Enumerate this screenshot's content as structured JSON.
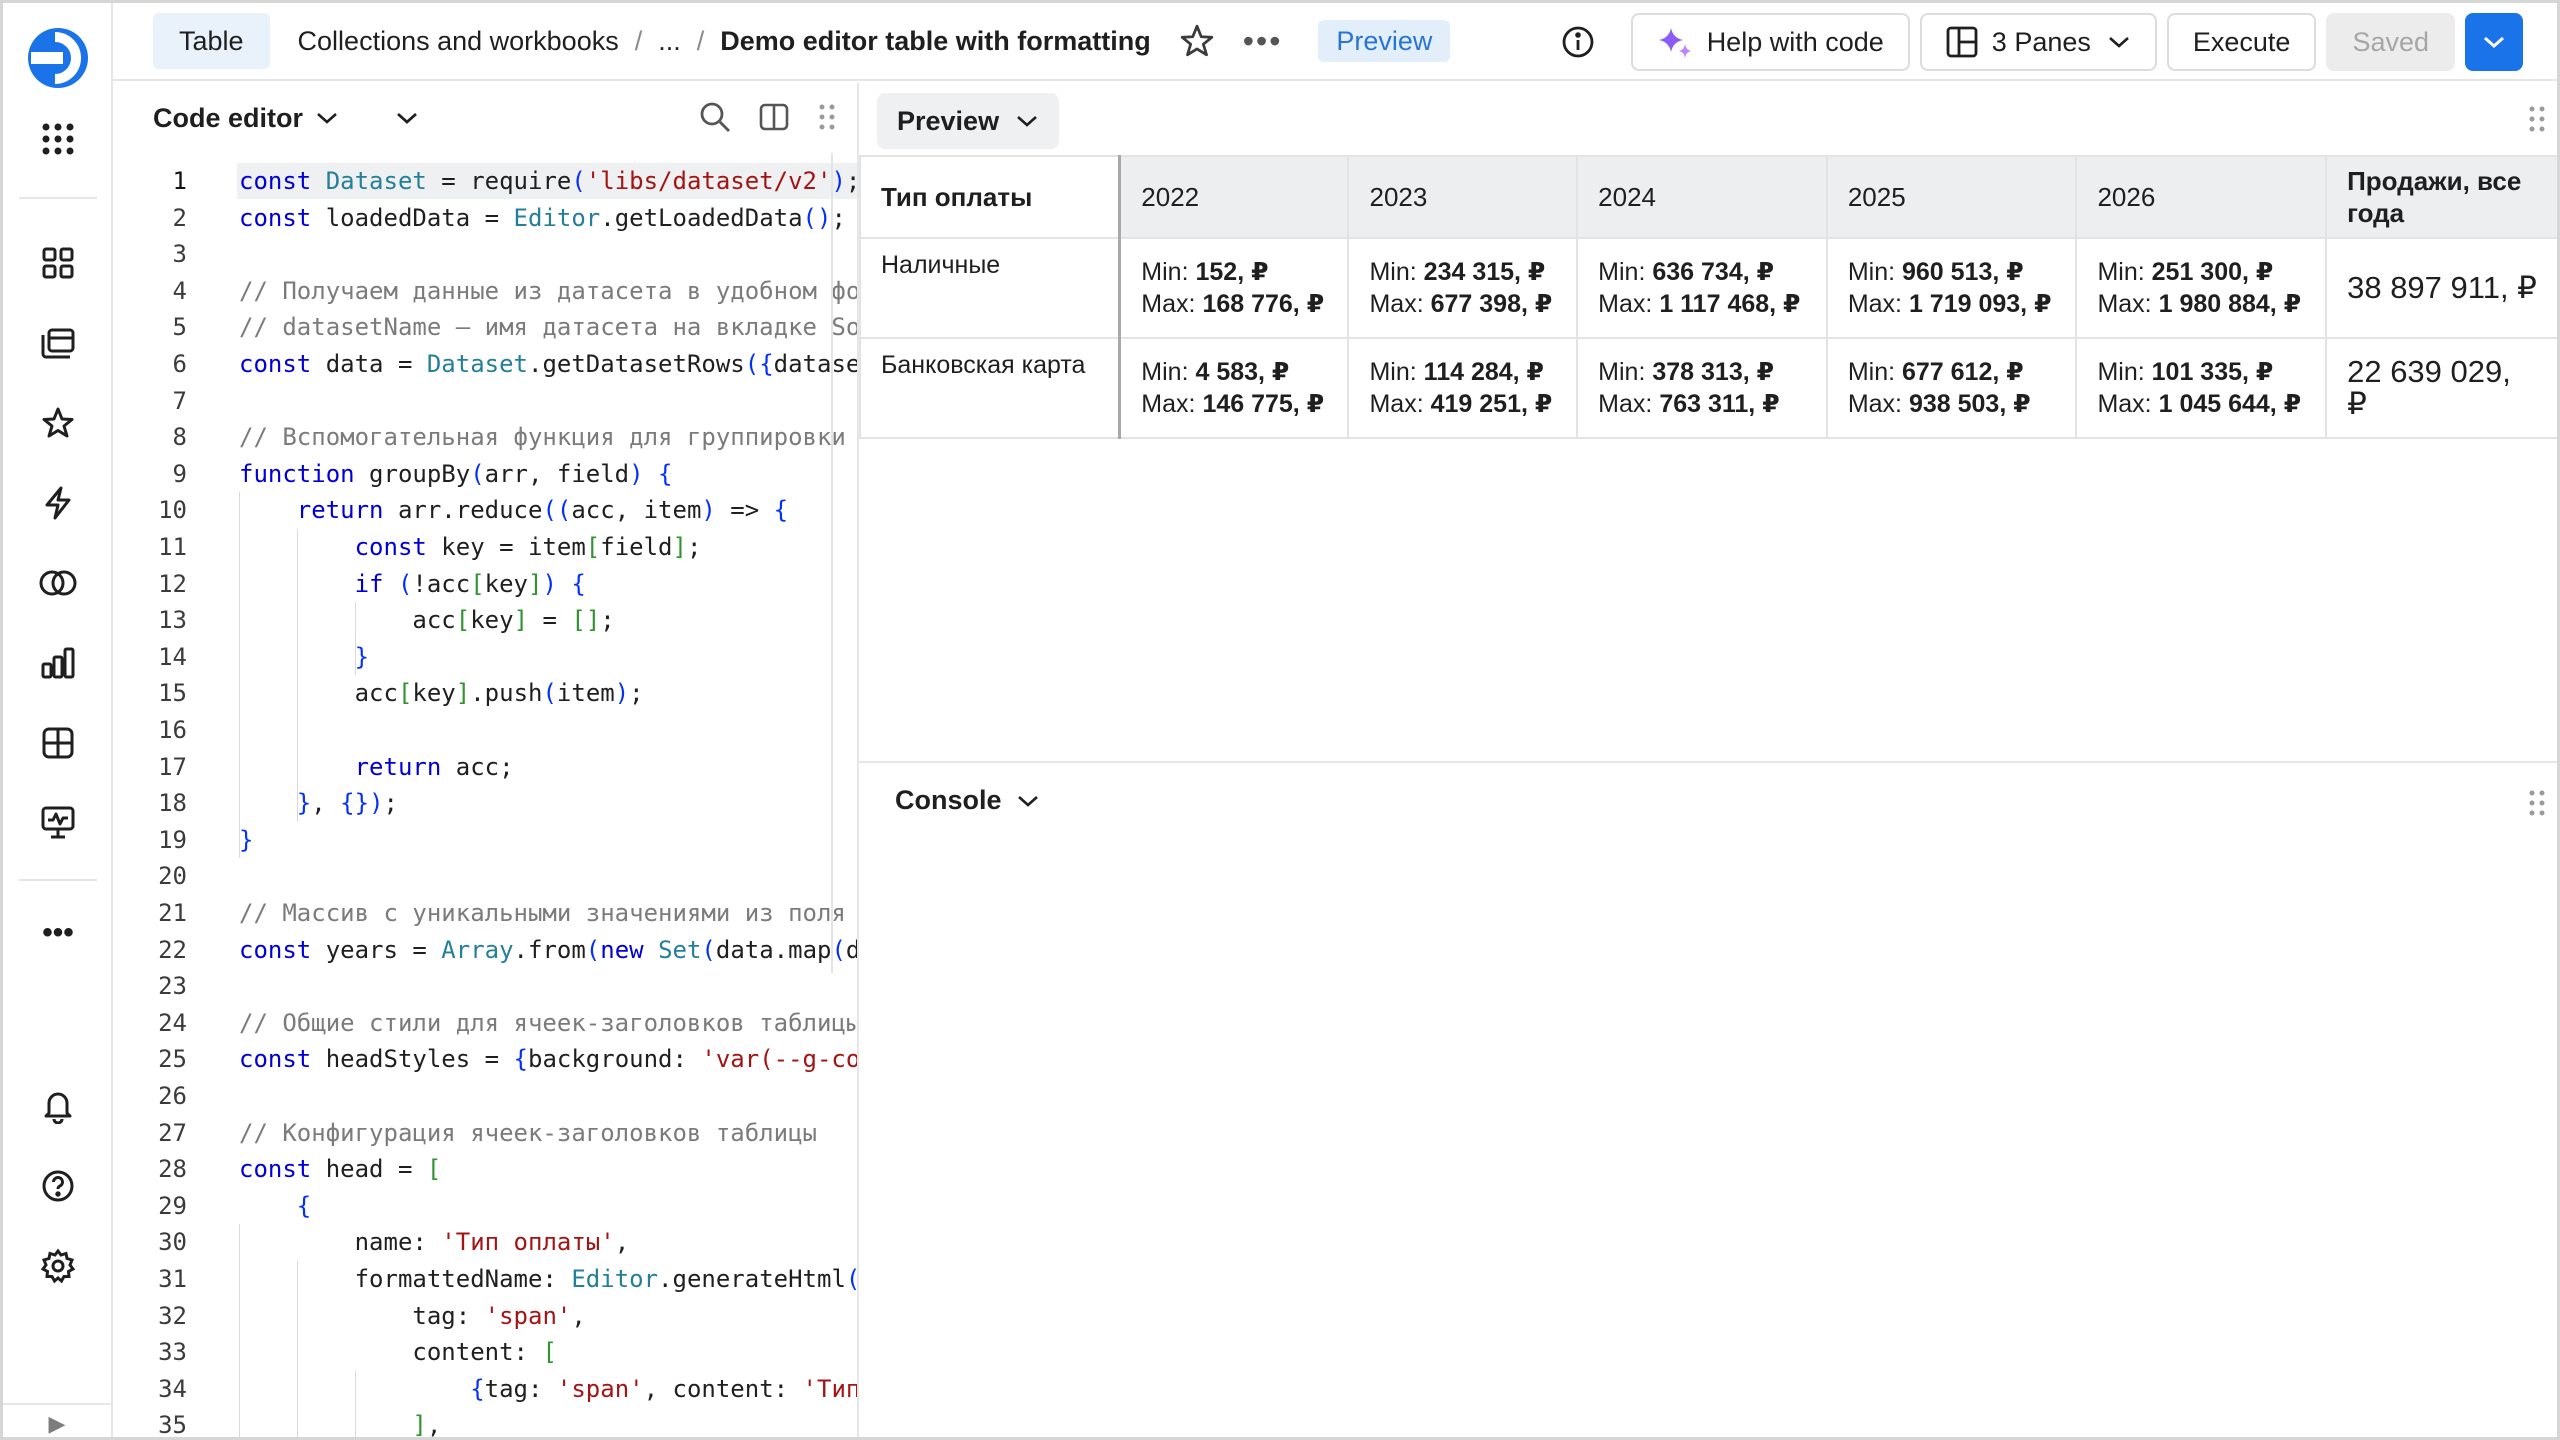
{
  "rail": {
    "icons": [
      "logo-icon",
      "apps-grid-icon",
      "dashboards-icon",
      "collections-icon",
      "favorites-icon",
      "connections-icon",
      "datasets-icon",
      "charts-icon",
      "reports-icon",
      "monitoring-icon",
      "more-icon",
      "notifications-icon",
      "help-icon",
      "settings-icon",
      "collapse-icon"
    ],
    "more_label": "•••",
    "collapse_label": "▶"
  },
  "header": {
    "tab_label": "Table",
    "breadcrumb": [
      "Collections and workbooks",
      "..."
    ],
    "separator": "/",
    "title": "Demo editor table with formatting",
    "more_label": "•••",
    "preview_label": "Preview",
    "help_label": "Help with code",
    "panes_label": "3 Panes",
    "execute_label": "Execute",
    "saved_label": "Saved"
  },
  "editor": {
    "title": "Code editor",
    "lines": [
      "const Dataset = require('libs/dataset/v2');",
      "const loadedData = Editor.getLoadedData();",
      "",
      "// Получаем данные из датасета в удобном фо",
      "// datasetName — имя датасета на вкладке So",
      "const data = Dataset.getDatasetRows({datase",
      "",
      "// Вспомогательная функция для группировки",
      "function groupBy(arr, field) {",
      "    return arr.reduce((acc, item) => {",
      "        const key = item[field];",
      "        if (!acc[key]) {",
      "            acc[key] = [];",
      "        }",
      "        acc[key].push(item);",
      "",
      "        return acc;",
      "    }, {});",
      "}",
      "",
      "// Массив с уникальными значениями из поля",
      "const years = Array.from(new Set(data.map(d",
      "",
      "// Общие стили для ячеек-заголовков таблицы",
      "const headStyles = {background: 'var(--g-co",
      "",
      "// Конфигурация ячеек-заголовков таблицы",
      "const head = [",
      "    {",
      "        name: 'Тип оплаты',",
      "        formattedName: Editor.generateHtml(",
      "            tag: 'span',",
      "            content: [",
      "                {tag: 'span', content: 'Тип",
      "            ],",
      "        })."
    ]
  },
  "preview": {
    "tab_label": "Preview",
    "table": {
      "head": [
        "Тип оплаты",
        "2022",
        "2023",
        "2024",
        "2025",
        "2026",
        "Продажи, все года"
      ],
      "rows": [
        {
          "label": "Наличные",
          "cells": [
            {
              "min_label": "Min:",
              "min": "152, ₽",
              "max_label": "Max:",
              "max": "168 776, ₽"
            },
            {
              "min_label": "Min:",
              "min": "234 315, ₽",
              "max_label": "Max:",
              "max": "677 398, ₽"
            },
            {
              "min_label": "Min:",
              "min": "636 734, ₽",
              "max_label": "Max:",
              "max": "1 117 468, ₽"
            },
            {
              "min_label": "Min:",
              "min": "960 513, ₽",
              "max_label": "Max:",
              "max": "1 719 093, ₽"
            },
            {
              "min_label": "Min:",
              "min": "251 300, ₽",
              "max_label": "Max:",
              "max": "1 980 884, ₽"
            }
          ],
          "total": "38 897 911, ₽"
        },
        {
          "label": "Банковская карта",
          "cells": [
            {
              "min_label": "Min:",
              "min": "4 583, ₽",
              "max_label": "Max:",
              "max": "146 775, ₽"
            },
            {
              "min_label": "Min:",
              "min": "114 284, ₽",
              "max_label": "Max:",
              "max": "419 251, ₽"
            },
            {
              "min_label": "Min:",
              "min": "378 313, ₽",
              "max_label": "Max:",
              "max": "763 311, ₽"
            },
            {
              "min_label": "Min:",
              "min": "677 612, ₽",
              "max_label": "Max:",
              "max": "938 503, ₽"
            },
            {
              "min_label": "Min:",
              "min": "101 335, ₽",
              "max_label": "Max:",
              "max": "1 045 644, ₽"
            }
          ],
          "total": "22 639 029, ₽"
        }
      ]
    }
  },
  "console": {
    "tab_label": "Console"
  },
  "colors": {
    "accent": "#1a73e8",
    "badge_bg": "#e2effb",
    "header_cell_bg": "#eceef0"
  }
}
